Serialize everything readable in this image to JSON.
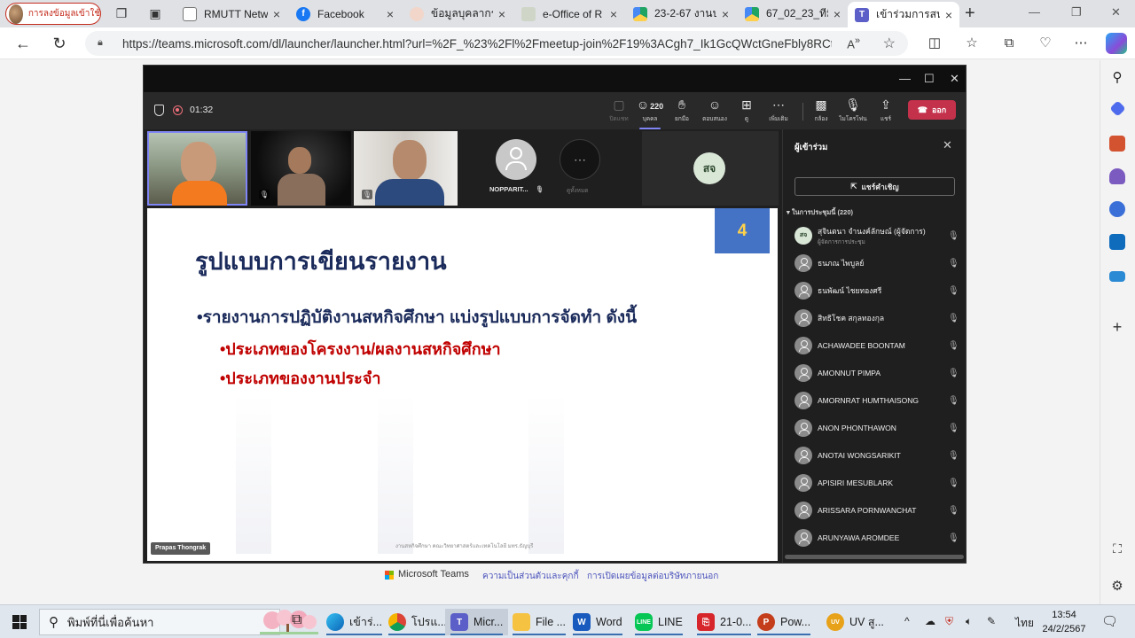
{
  "browser": {
    "profile_label": "การลงข้อมูลเข้าใช้",
    "tabs": [
      {
        "label": "RMUTT Netw",
        "icon": "document-icon"
      },
      {
        "label": "Facebook",
        "icon": "facebook-icon"
      },
      {
        "label": "ข้อมูลบุคลากร",
        "icon": "drop-icon"
      },
      {
        "label": "e-Office of R",
        "icon": "eoffice-icon"
      },
      {
        "label": "23-2-67 งานป",
        "icon": "google-drive-icon"
      },
      {
        "label": "67_02_23_ทีมี",
        "icon": "google-drive-icon"
      },
      {
        "label": "เข้าร่วมการสนท",
        "icon": "teams-icon"
      }
    ],
    "url": "https://teams.microsoft.com/dl/launcher/launcher.html?url=%2F_%23%2Fl%2Fmeetup-join%2F19%3ACgh7_Ik1GcQWctGneFbly8RCtyhqkf..."
  },
  "meeting": {
    "timer": "01:32",
    "toolbar": [
      {
        "label": "ปิดแชท",
        "icon": "chat-icon",
        "dim": true
      },
      {
        "label": "บุคคล",
        "icon": "people-icon",
        "count": "220",
        "selected": true
      },
      {
        "label": "ยกมือ",
        "icon": "raise-hand-icon"
      },
      {
        "label": "ตอบสนอง",
        "icon": "react-icon"
      },
      {
        "label": "ดู",
        "icon": "view-icon"
      },
      {
        "label": "เพิ่มเติม",
        "icon": "more-icon"
      },
      {
        "label": "กล้อง",
        "icon": "camera-off-icon"
      },
      {
        "label": "ไมโครโฟน",
        "icon": "mic-off-icon"
      },
      {
        "label": "แชร์",
        "icon": "share-icon"
      }
    ],
    "leave_label": "ออก",
    "tiles": {
      "participant_name": "NOPPARIT...",
      "more_label": "ดูทั้งหมด",
      "initials": "สจ"
    },
    "slide": {
      "number": "4",
      "title": "รูปแบบการเขียนรายงาน",
      "bullet_main": "•รายงานการปฏิบัติงานสหกิจศึกษา แบ่งรูปแบบการจัดทำ ดังนี้",
      "sub_bullets": [
        "•ประเภทของโครงงาน/ผลงานสหกิจศึกษา",
        "•ประเภทของงานประจำ"
      ],
      "footer": "งานสหกิจศึกษา คณะวิทยาศาสตร์และเทคโนโลยี มทร.ธัญบุรี"
    },
    "speaker_tag": "Prapas Thongrak",
    "participants_panel": {
      "title": "ผู้เข้าร่วม",
      "share_invite": "แชร์คำเชิญ",
      "section": "ในการประชุมนี้ (220)",
      "people": [
        {
          "name": "สุจินตนา จำนงค์ลักษณ์ (ผู้จัดการ)",
          "role": "ผู้จัดการการประชุม",
          "initials": "สจ"
        },
        {
          "name": "ธนภณ ไพบูลย์"
        },
        {
          "name": "ธนพัฒน์ ไชยทองศรี"
        },
        {
          "name": "สิทธิโชค สกุลทองกุล"
        },
        {
          "name": "ACHAWADEE BOONTAM"
        },
        {
          "name": "AMONNUT PIMPA"
        },
        {
          "name": "AMORNRAT HUMTHAISONG"
        },
        {
          "name": "ANON PHONTHAWON"
        },
        {
          "name": "ANOTAI WONGSARIKIT"
        },
        {
          "name": "APISIRI MESUBLARK"
        },
        {
          "name": "ARISSARA PORNWANCHAT"
        },
        {
          "name": "ARUNYAWA AROMDEE"
        }
      ]
    }
  },
  "page_footer": {
    "brand": "Microsoft Teams",
    "privacy": "ความเป็นส่วนตัวและคุกกี้",
    "third_party": "การเปิดเผยข้อมูลต่อบริษัทภายนอก"
  },
  "taskbar": {
    "search_placeholder": "พิมพ์ที่นี่เพื่อค้นหา",
    "apps": [
      {
        "label": "เข้าร่...",
        "icon": "edge-icon"
      },
      {
        "label": "โปรแ...",
        "icon": "chrome-icon"
      },
      {
        "label": "Micr...",
        "icon": "teams-icon"
      },
      {
        "label": "File ...",
        "icon": "file-explorer-icon"
      },
      {
        "label": "Word",
        "icon": "word-icon"
      },
      {
        "label": "LINE",
        "icon": "line-icon"
      },
      {
        "label": "21-0...",
        "icon": "pdf-icon"
      },
      {
        "label": "Pow...",
        "icon": "powerpoint-icon"
      },
      {
        "label": "UV สู...",
        "icon": "uv-icon"
      }
    ],
    "language": "ไทย",
    "time": "13:54",
    "date": "24/2/2567"
  },
  "colors": {
    "accent": "#7f85f5",
    "leave": "#c4314b",
    "slide_title": "#1a2a5a",
    "slide_sub": "#c00000",
    "slide_number_bg": "#4472c4"
  }
}
